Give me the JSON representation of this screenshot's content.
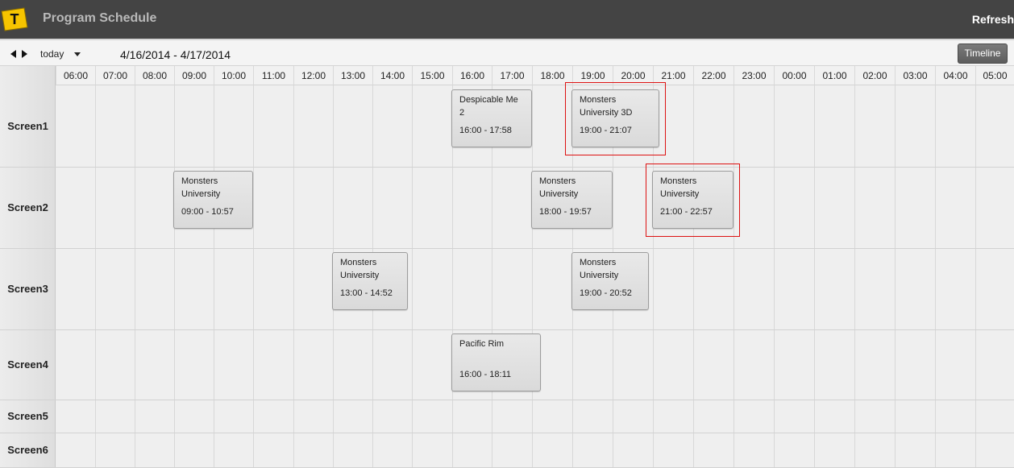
{
  "header": {
    "title": "Program Schedule",
    "refresh_label": "Refresh",
    "logo_letter": "T"
  },
  "toolbar": {
    "today_label": "today",
    "date_range": "4/16/2014 - 4/17/2014",
    "view_label": "Timeline"
  },
  "hours": [
    "06:00",
    "07:00",
    "08:00",
    "09:00",
    "10:00",
    "11:00",
    "12:00",
    "13:00",
    "14:00",
    "15:00",
    "16:00",
    "17:00",
    "18:00",
    "19:00",
    "20:00",
    "21:00",
    "22:00",
    "23:00",
    "00:00",
    "01:00",
    "02:00",
    "03:00",
    "04:00",
    "05:00"
  ],
  "screens": [
    "Screen1",
    "Screen2",
    "Screen3",
    "Screen4",
    "Screen5",
    "Screen6"
  ],
  "events": [
    {
      "screen": "Screen1",
      "title": "Despicable Me 2",
      "time": "16:00 - 17:58",
      "highlighted": false
    },
    {
      "screen": "Screen1",
      "title": "Monsters University 3D",
      "time": "19:00 - 21:07",
      "highlighted": true
    },
    {
      "screen": "Screen2",
      "title": "Monsters University",
      "time": "09:00 - 10:57",
      "highlighted": false
    },
    {
      "screen": "Screen2",
      "title": "Monsters University",
      "time": "18:00 - 19:57",
      "highlighted": false
    },
    {
      "screen": "Screen2",
      "title": "Monsters University",
      "time": "21:00 - 22:57",
      "highlighted": true
    },
    {
      "screen": "Screen3",
      "title": "Monsters University",
      "time": "13:00 - 14:52",
      "highlighted": false
    },
    {
      "screen": "Screen3",
      "title": "Monsters University",
      "time": "19:00 - 20:52",
      "highlighted": false
    },
    {
      "screen": "Screen4",
      "title": "Pacific Rim",
      "time": "16:00 - 18:11",
      "highlighted": false
    }
  ]
}
